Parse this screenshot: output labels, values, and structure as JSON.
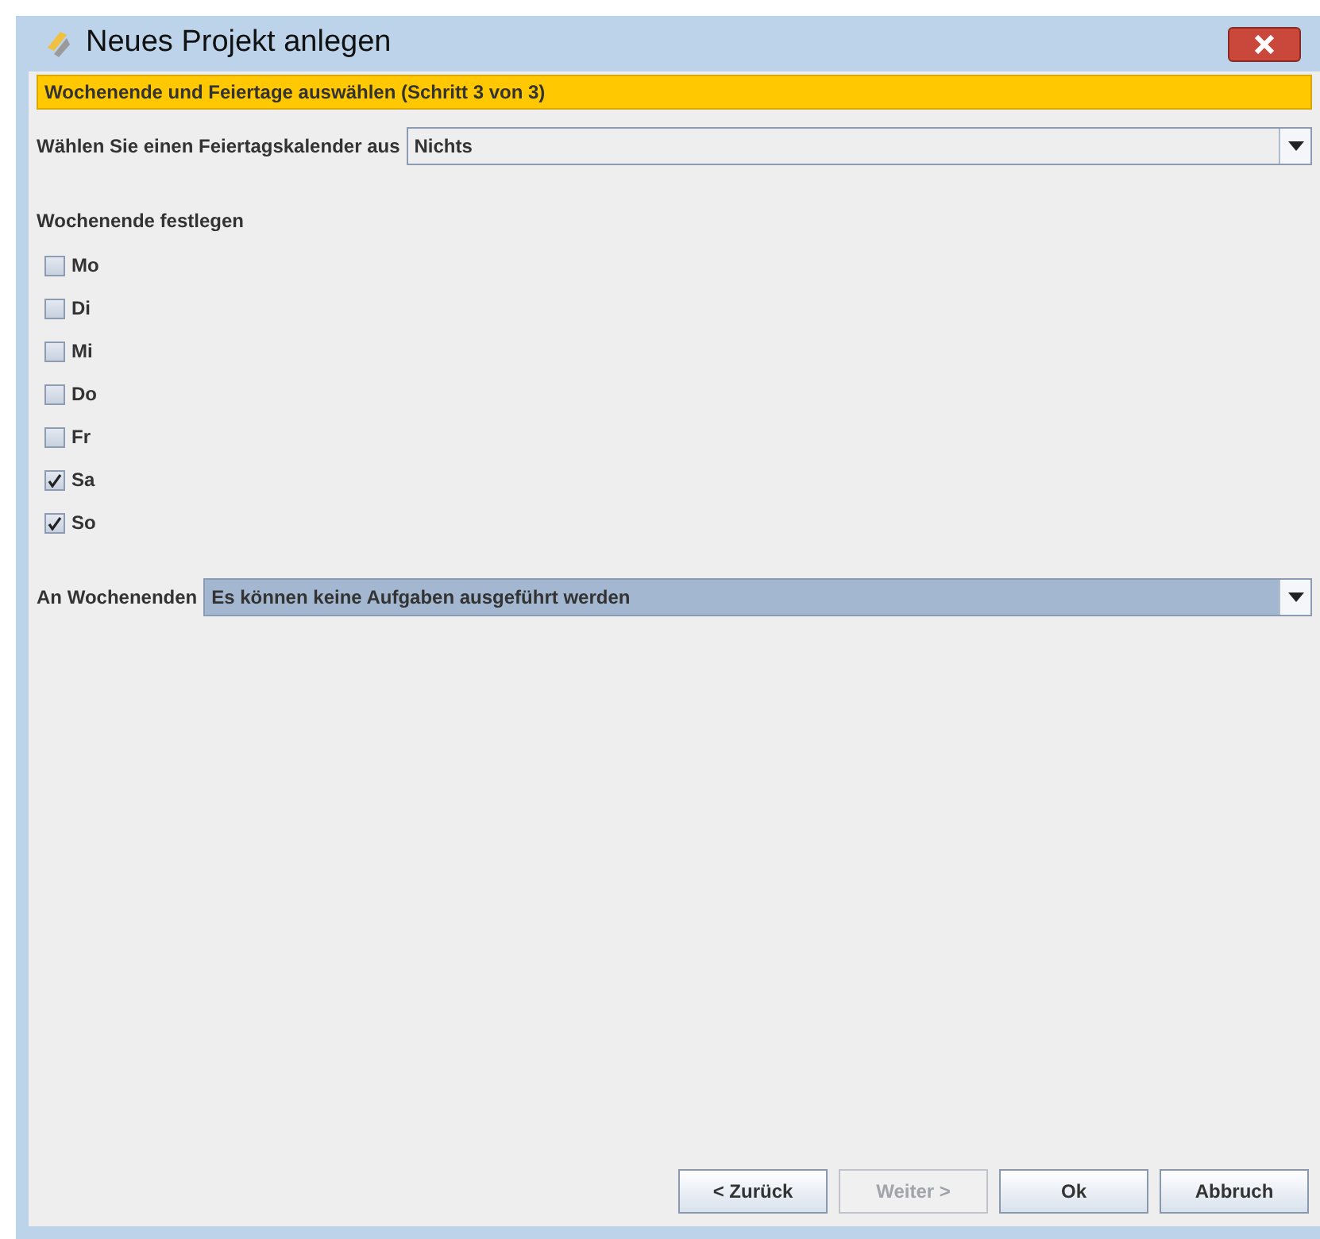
{
  "window": {
    "title": "Neues Projekt anlegen"
  },
  "step_banner": "Wochenende und Feiertage auswählen (Schritt 3 von 3)",
  "holiday_calendar": {
    "label": "Wählen Sie einen Feiertagskalender aus",
    "value": "Nichts"
  },
  "weekend": {
    "heading": "Wochenende festlegen",
    "days": [
      {
        "label": "Mo",
        "checked": false
      },
      {
        "label": "Di",
        "checked": false
      },
      {
        "label": "Mi",
        "checked": false
      },
      {
        "label": "Do",
        "checked": false
      },
      {
        "label": "Fr",
        "checked": false
      },
      {
        "label": "Sa",
        "checked": true
      },
      {
        "label": "So",
        "checked": true
      }
    ]
  },
  "weekend_mode": {
    "label": "An Wochenenden",
    "value": "Es können keine Aufgaben ausgeführt werden"
  },
  "buttons": [
    {
      "label": "< Zurück",
      "disabled": false
    },
    {
      "label": "Weiter >",
      "disabled": true
    },
    {
      "label": "Ok",
      "disabled": false
    },
    {
      "label": "Abbruch",
      "disabled": false
    }
  ]
}
